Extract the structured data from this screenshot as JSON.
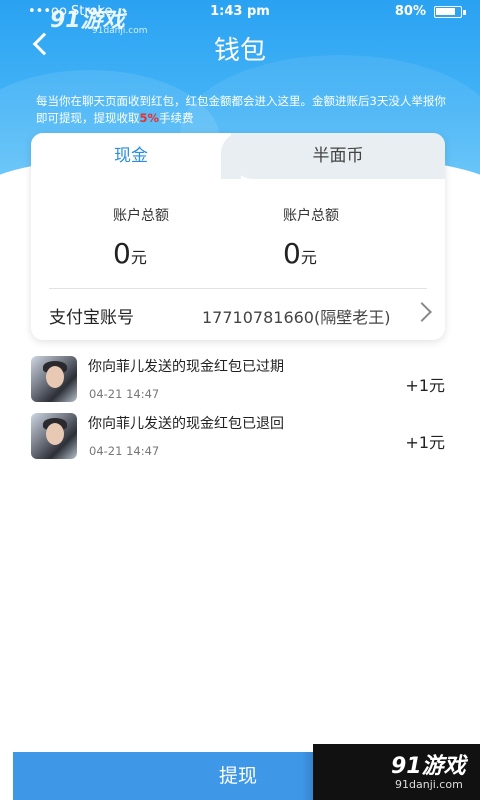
{
  "status_bar": {
    "carrier": "•••oo Stroke",
    "time": "1:43 pm",
    "battery": "80%"
  },
  "watermark": {
    "top_logo": "91游戏",
    "top_domain": "91danji.com",
    "bottom_logo": "91游戏",
    "bottom_domain": "91danji.com"
  },
  "header": {
    "title": "钱包",
    "notice_part1": "每当你在聊天页面收到红包，红包金额都会进入这里。金额进账后3天没人举报你即可提现，提现收取",
    "notice_pct": "5%",
    "notice_part2": "手续费"
  },
  "tabs": [
    {
      "label": "现金",
      "active": true
    },
    {
      "label": "半面币",
      "active": false
    }
  ],
  "balances": [
    {
      "label": "账户总额",
      "amount": "0",
      "unit": "元"
    },
    {
      "label": "账户总额",
      "amount": "0",
      "unit": "元"
    }
  ],
  "alipay": {
    "label": "支付宝账号",
    "value": "17710781660(隔壁老王)"
  },
  "transactions": [
    {
      "message": "你向菲儿发送的现金红包已过期",
      "time": "04-21 14:47",
      "amount": "+1元"
    },
    {
      "message": "你向菲儿发送的现金红包已退回",
      "time": "04-21 14:47",
      "amount": "+1元"
    }
  ],
  "footer": {
    "withdraw_label": "提现"
  },
  "colors": {
    "header_blue": "#2aa2f2",
    "tab_active": "#2a8fe0",
    "button_blue": "#3f97e8",
    "fee_red": "#e8302c"
  }
}
